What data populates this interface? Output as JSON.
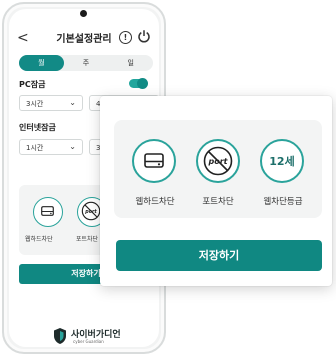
{
  "header": {
    "title": "기본설정관리",
    "back_glyph": "<",
    "info_glyph": "!"
  },
  "period_tabs": [
    {
      "label": "월",
      "active": true
    },
    {
      "label": "주",
      "active": false
    },
    {
      "label": "일",
      "active": false
    }
  ],
  "pc_lock": {
    "label": "PC잠금",
    "enabled": true,
    "hours_value": "3시간",
    "minutes_value": "40"
  },
  "internet_lock": {
    "label": "인터넷잠금",
    "hours_value": "1시간",
    "minutes_value": "30"
  },
  "block_features": [
    {
      "label": "웹하드차단",
      "icon": "hard-drive-icon"
    },
    {
      "label": "포트차단",
      "icon": "port-blocked-icon",
      "icon_text": "port"
    },
    {
      "label": "웹차단등급",
      "icon": "age-rating-icon",
      "icon_text": "12세"
    }
  ],
  "save_label": "저장하기",
  "brand": {
    "name": "사이버가디언",
    "tagline": "cyber Guardian"
  },
  "colors": {
    "accent": "#108882",
    "accent_light": "#2aa39b",
    "card_bg": "#f3f4f4"
  }
}
